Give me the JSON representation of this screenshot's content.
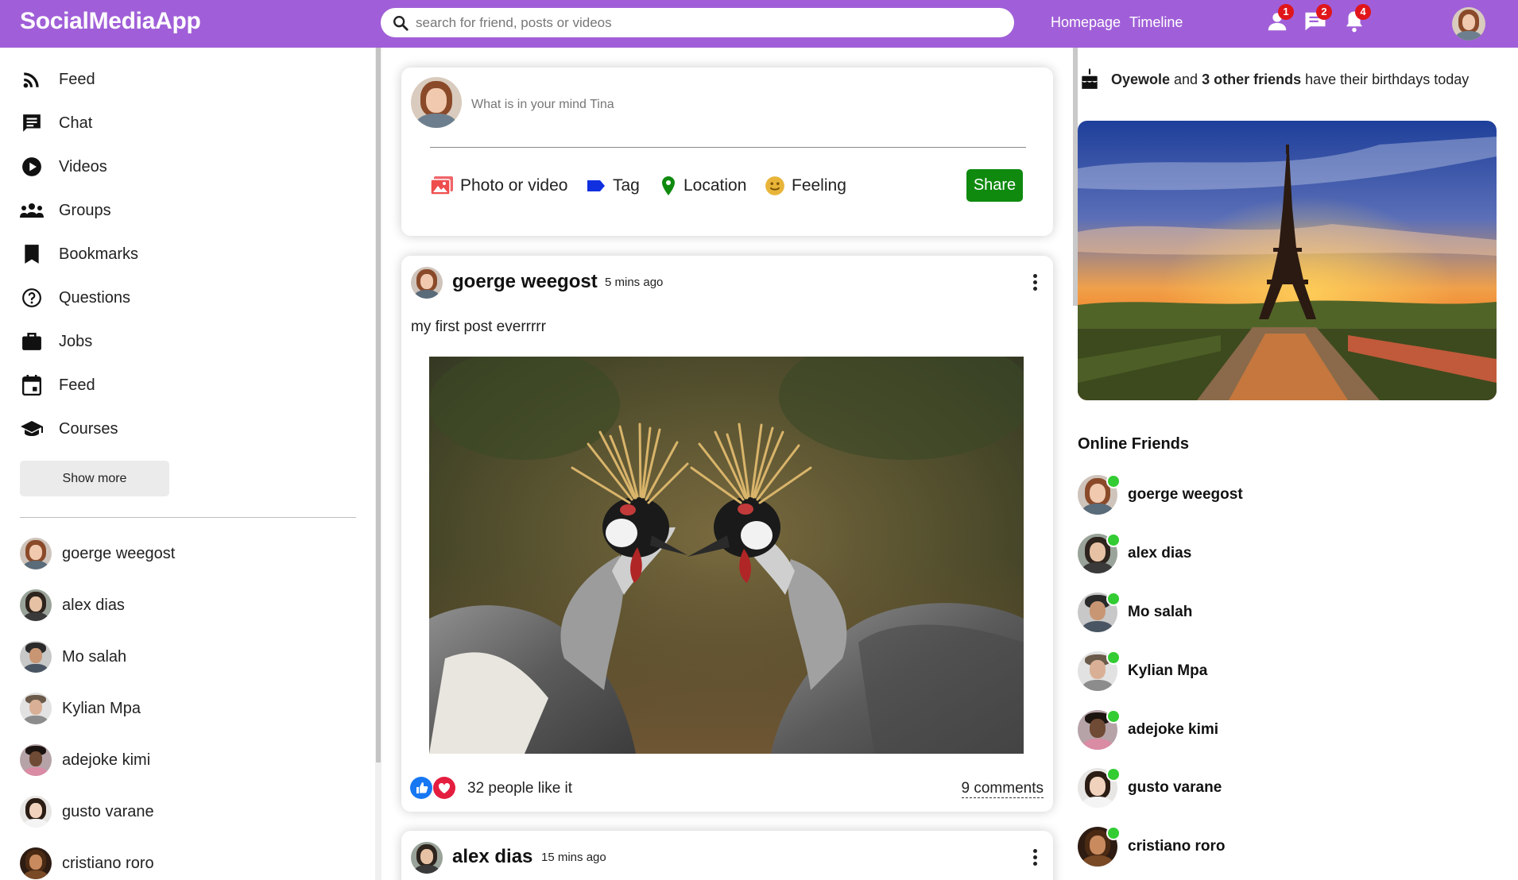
{
  "app": {
    "title": "SocialMediaApp"
  },
  "search": {
    "placeholder": "search for friend, posts or videos"
  },
  "topnav": {
    "links": [
      "Homepage",
      "Timeline"
    ]
  },
  "notifications": {
    "friend_requests": "1",
    "messages": "2",
    "alerts": "4"
  },
  "sidebar": {
    "items": [
      {
        "label": "Feed",
        "icon": "rss-feed-icon"
      },
      {
        "label": "Chat",
        "icon": "chat-icon"
      },
      {
        "label": "Videos",
        "icon": "play-circle-icon"
      },
      {
        "label": "Groups",
        "icon": "groups-icon"
      },
      {
        "label": "Bookmarks",
        "icon": "bookmark-icon"
      },
      {
        "label": "Questions",
        "icon": "help-circle-icon"
      },
      {
        "label": "Jobs",
        "icon": "work-briefcase-icon"
      },
      {
        "label": "Feed",
        "icon": "calendar-icon"
      },
      {
        "label": "Courses",
        "icon": "school-icon"
      }
    ],
    "show_more_label": "Show more",
    "friends": [
      "goerge weegost",
      "alex dias",
      "Mo salah",
      "Kylian Mpa",
      "adejoke kimi",
      "gusto varane",
      "cristiano roro"
    ]
  },
  "share": {
    "placeholder": "What is in your mind Tina",
    "options": [
      "Photo or video",
      "Tag",
      "Location",
      "Feeling"
    ],
    "share_label": "Share"
  },
  "posts": [
    {
      "author": "goerge weegost",
      "time": "5 mins ago",
      "text": "my first post everrrrr",
      "likes_text": "32 people like it",
      "comments_text": "9 comments"
    },
    {
      "author": "alex dias",
      "time": "15 mins ago"
    }
  ],
  "rightbar": {
    "birthday": {
      "name": "Oyewole",
      "middle": " and ",
      "count": "3 other friends",
      "suffix": " have their birthdays today"
    },
    "online_title": "Online Friends",
    "online_friends": [
      "goerge weegost",
      "alex dias",
      "Mo salah",
      "Kylian Mpa",
      "adejoke kimi",
      "gusto varane",
      "cristiano roro"
    ]
  },
  "colors": {
    "topbar": "#a05fd8",
    "share_button": "#0f8a0f",
    "online": "#33cc33",
    "badge": "#e0161b"
  }
}
